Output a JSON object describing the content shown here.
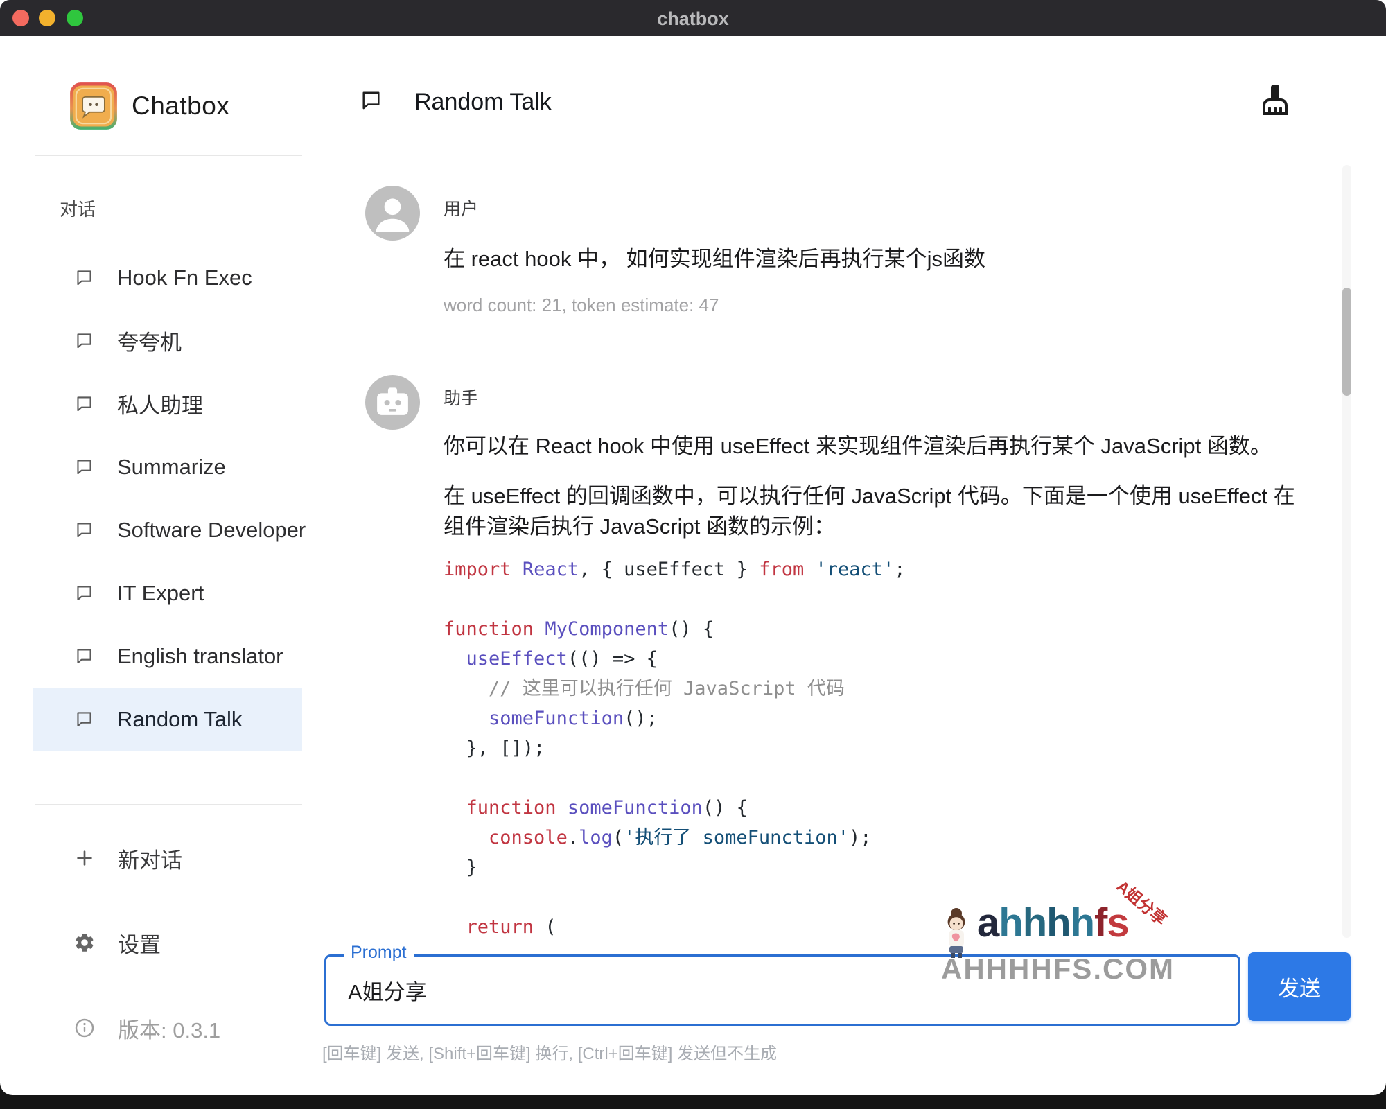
{
  "window": {
    "title": "chatbox",
    "traffic_lights": [
      "#f36a5f",
      "#f2b12d",
      "#2fc63e"
    ]
  },
  "sidebar": {
    "app_name": "Chatbox",
    "section_label": "对话",
    "items": [
      {
        "label": "Hook Fn Exec",
        "selected": false
      },
      {
        "label": "夸夸机",
        "selected": false
      },
      {
        "label": "私人助理",
        "selected": false
      },
      {
        "label": "Summarize",
        "selected": false
      },
      {
        "label": "Software Developer",
        "selected": false
      },
      {
        "label": "IT Expert",
        "selected": false
      },
      {
        "label": "English translator",
        "selected": false
      },
      {
        "label": "Random Talk",
        "selected": true
      }
    ],
    "new_chat_label": "新对话",
    "settings_label": "设置",
    "version_label": "版本: 0.3.1"
  },
  "header": {
    "title": "Random Talk"
  },
  "chat": {
    "user": {
      "role_label": "用户",
      "message": "在 react hook 中， 如何实现组件渲染后再执行某个js函数",
      "meta": "word count: 21, token estimate: 47"
    },
    "assistant": {
      "role_label": "助手",
      "paragraph1": "你可以在 React hook 中使用 useEffect 来实现组件渲染后再执行某个 JavaScript 函数。",
      "paragraph2_lines": [
        "在 useEffect 的回调函数中，可以执行任何 JavaScript 代码。下面是一个使用 useEffect 在",
        "组件渲染后执行 JavaScript 函数的示例："
      ],
      "code_lines": [
        [
          {
            "t": "import",
            "c": "kw"
          },
          {
            "t": " "
          },
          {
            "t": "React",
            "c": "fn"
          },
          {
            "t": ", { useEffect } "
          },
          {
            "t": "from",
            "c": "kw"
          },
          {
            "t": " "
          },
          {
            "t": "'react'",
            "c": "str"
          },
          {
            "t": ";"
          }
        ],
        [],
        [
          {
            "t": "function",
            "c": "kw"
          },
          {
            "t": " "
          },
          {
            "t": "MyComponent",
            "c": "fn"
          },
          {
            "t": "() {"
          }
        ],
        [
          {
            "t": "  "
          },
          {
            "t": "useEffect",
            "c": "fn"
          },
          {
            "t": "(() => {"
          }
        ],
        [
          {
            "t": "    // 这里可以执行任何 JavaScript 代码",
            "c": "cm"
          }
        ],
        [
          {
            "t": "    "
          },
          {
            "t": "someFunction",
            "c": "fn"
          },
          {
            "t": "();"
          }
        ],
        [
          {
            "t": "  }, []);"
          }
        ],
        [],
        [
          {
            "t": "  "
          },
          {
            "t": "function",
            "c": "kw"
          },
          {
            "t": " "
          },
          {
            "t": "someFunction",
            "c": "fn"
          },
          {
            "t": "() {"
          }
        ],
        [
          {
            "t": "    "
          },
          {
            "t": "console",
            "c": "kw"
          },
          {
            "t": "."
          },
          {
            "t": "log",
            "c": "fn"
          },
          {
            "t": "("
          },
          {
            "t": "'执行了 someFunction'",
            "c": "str"
          },
          {
            "t": ");"
          }
        ],
        [
          {
            "t": "  }"
          }
        ],
        [],
        [
          {
            "t": "  "
          },
          {
            "t": "return",
            "c": "kw"
          },
          {
            "t": " ("
          }
        ]
      ]
    }
  },
  "prompt": {
    "label": "Prompt",
    "value": "A姐分享",
    "send_label": "发送",
    "hint": "[回车键] 发送, [Shift+回车键] 换行, [Ctrl+回车键] 发送但不生成"
  },
  "watermark": {
    "wordmark_letters": [
      {
        "ch": "a",
        "color": "#23283c"
      },
      {
        "ch": "h",
        "color": "#2d7793"
      },
      {
        "ch": "h",
        "color": "#27687f"
      },
      {
        "ch": "h",
        "color": "#1f5871"
      },
      {
        "ch": "h",
        "color": "#2d7793"
      },
      {
        "ch": "f",
        "color": "#8e242c"
      },
      {
        "ch": "s",
        "color": "#c23a3e"
      }
    ],
    "tagline": "A姐分享",
    "domain": "AHHHHFS.COM"
  },
  "colors": {
    "accent_blue": "#2b6fd2",
    "send_blue": "#2d79e6",
    "selected_item_bg": "#e9f1fb",
    "code_keyword": "#c13541",
    "code_function": "#5a4fbe",
    "code_string": "#134e76",
    "code_comment": "#8f8f8f"
  }
}
